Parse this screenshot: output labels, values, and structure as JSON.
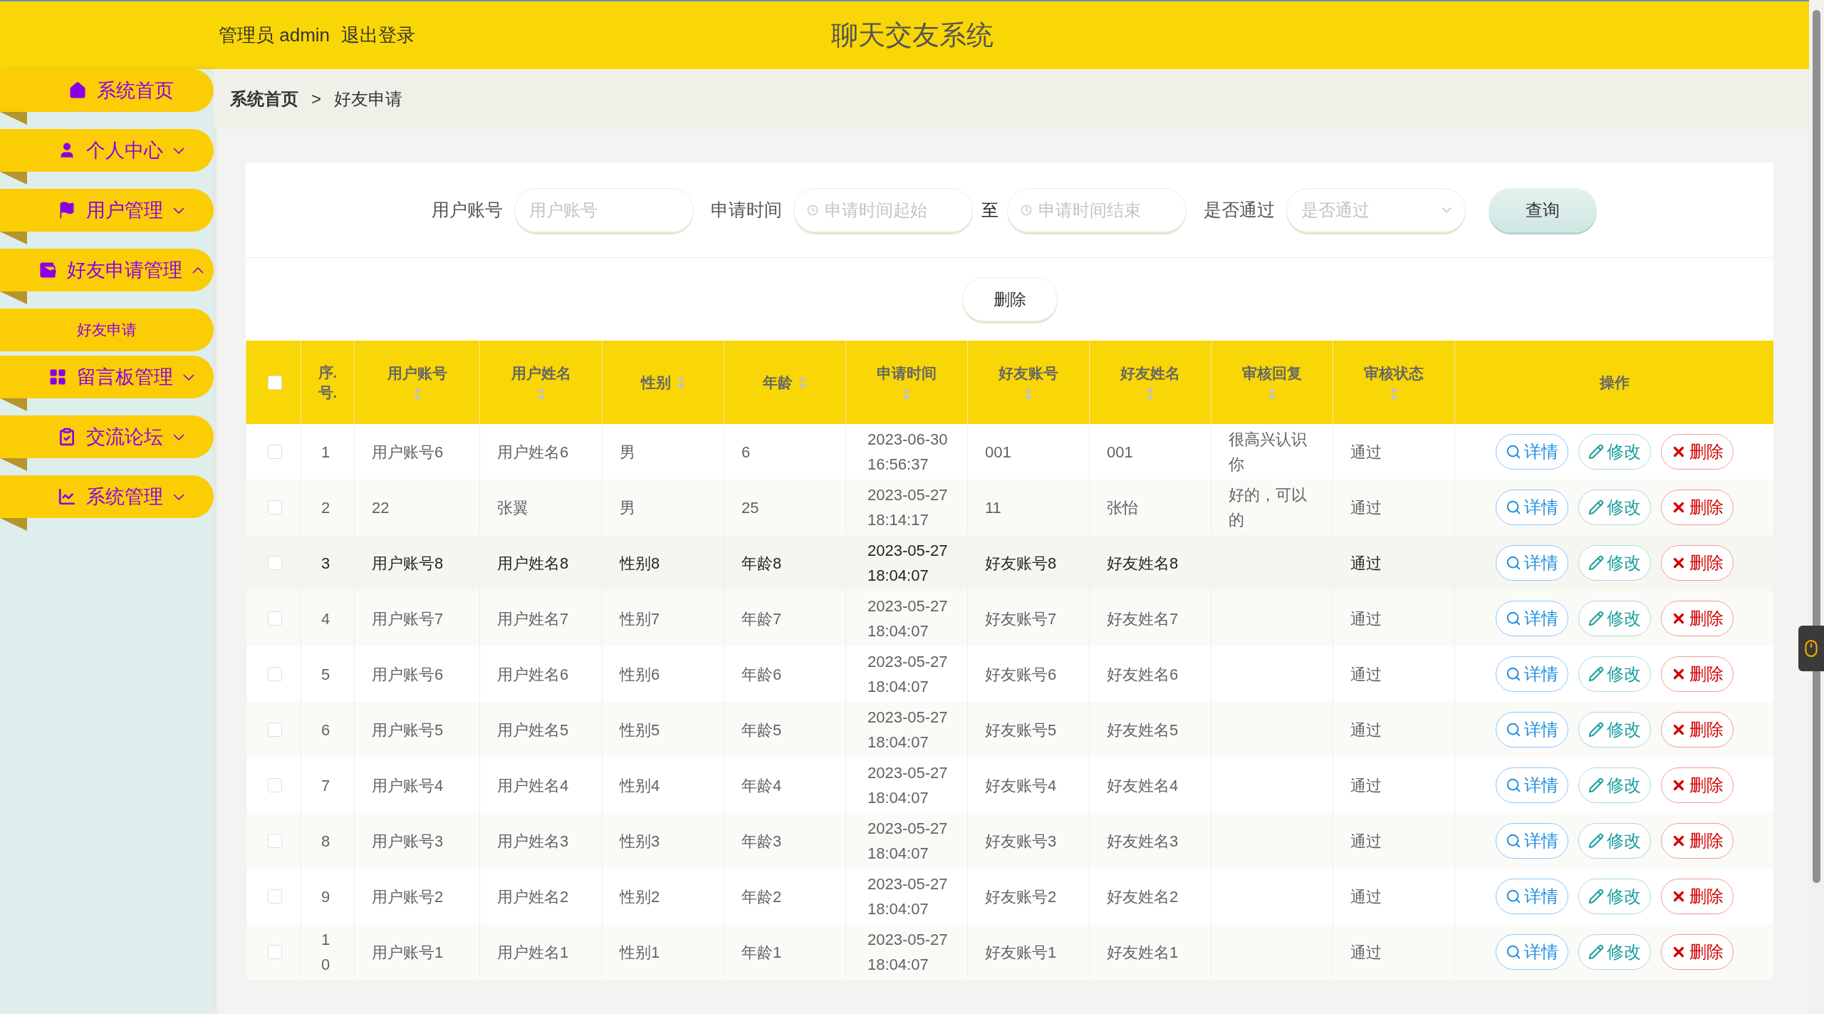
{
  "header": {
    "user_role": "管理员",
    "username": "admin",
    "logout": "退出登录",
    "title": "聊天交友系统"
  },
  "sidebar": {
    "items": [
      {
        "label": "系统首页",
        "kind": "home",
        "expandable": false
      },
      {
        "label": "个人中心",
        "kind": "user",
        "expandable": true,
        "expanded": false
      },
      {
        "label": "用户管理",
        "kind": "flag",
        "expandable": true,
        "expanded": false
      },
      {
        "label": "好友申请管理",
        "kind": "wallet",
        "expandable": true,
        "expanded": true,
        "children": [
          {
            "label": "好友申请"
          }
        ]
      },
      {
        "label": "留言板管理",
        "kind": "grid",
        "expandable": true,
        "expanded": false
      },
      {
        "label": "交流论坛",
        "kind": "clipboard",
        "expandable": true,
        "expanded": false
      },
      {
        "label": "系统管理",
        "kind": "chart",
        "expandable": true,
        "expanded": false
      }
    ]
  },
  "breadcrumb": {
    "items": [
      "系统首页",
      "好友申请"
    ],
    "separator": ">"
  },
  "search": {
    "fields": [
      {
        "kind": "text",
        "label": "用户账号",
        "placeholder": "用户账号"
      },
      {
        "kind": "daterange",
        "label": "申请时间",
        "start_placeholder": "申请时间起始",
        "separator": "至",
        "end_placeholder": "申请时间结束"
      },
      {
        "kind": "select",
        "label": "是否通过",
        "placeholder": "是否通过"
      }
    ],
    "button": "查询"
  },
  "bulk_delete": "删除",
  "table": {
    "select_all": {
      "checked": false
    },
    "columns": [
      {
        "label": "序.号.",
        "sortable": false
      },
      {
        "label": "用户账号",
        "sortable": true
      },
      {
        "label": "用户姓名",
        "sortable": true
      },
      {
        "label": "性别",
        "sortable": true
      },
      {
        "label": "年龄",
        "sortable": true
      },
      {
        "label": "申请时间",
        "sortable": true
      },
      {
        "label": "好友账号",
        "sortable": true
      },
      {
        "label": "好友姓名",
        "sortable": true
      },
      {
        "label": "审核回复",
        "sortable": true
      },
      {
        "label": "审核状态",
        "sortable": true
      },
      {
        "label": "操作",
        "sortable": false
      }
    ],
    "rows": [
      {
        "checked": false,
        "highlighted": false,
        "index": "1",
        "account": "用户账号6",
        "name": "用户姓名6",
        "gender": "男",
        "age": "6",
        "time": "2023-06-30 16:56:37",
        "friend_account": "001",
        "friend_name": "001",
        "reply": "很高兴认识你",
        "status": "通过",
        "actions": [
          "详情",
          "修改",
          "删除"
        ]
      },
      {
        "checked": false,
        "highlighted": false,
        "index": "2",
        "account": "22",
        "name": "张翼",
        "gender": "男",
        "age": "25",
        "time": "2023-05-27 18:14:17",
        "friend_account": "11",
        "friend_name": "张怡",
        "reply": "好的，可以的",
        "status": "通过",
        "actions": [
          "详情",
          "修改",
          "删除"
        ]
      },
      {
        "checked": false,
        "highlighted": true,
        "index": "3",
        "account": "用户账号8",
        "name": "用户姓名8",
        "gender": "性别8",
        "age": "年龄8",
        "time": "2023-05-27 18:04:07",
        "friend_account": "好友账号8",
        "friend_name": "好友姓名8",
        "status": "通过",
        "actions": [
          "详情",
          "修改",
          "删除"
        ]
      },
      {
        "checked": false,
        "highlighted": false,
        "index": "4",
        "account": "用户账号7",
        "name": "用户姓名7",
        "gender": "性别7",
        "age": "年龄7",
        "time": "2023-05-27 18:04:07",
        "friend_account": "好友账号7",
        "friend_name": "好友姓名7",
        "status": "通过",
        "actions": [
          "详情",
          "修改",
          "删除"
        ]
      },
      {
        "checked": false,
        "highlighted": false,
        "index": "5",
        "account": "用户账号6",
        "name": "用户姓名6",
        "gender": "性别6",
        "age": "年龄6",
        "time": "2023-05-27 18:04:07",
        "friend_account": "好友账号6",
        "friend_name": "好友姓名6",
        "status": "通过",
        "actions": [
          "详情",
          "修改",
          "删除"
        ]
      },
      {
        "checked": false,
        "highlighted": false,
        "index": "6",
        "account": "用户账号5",
        "name": "用户姓名5",
        "gender": "性别5",
        "age": "年龄5",
        "time": "2023-05-27 18:04:07",
        "friend_account": "好友账号5",
        "friend_name": "好友姓名5",
        "status": "通过",
        "actions": [
          "详情",
          "修改",
          "删除"
        ]
      },
      {
        "checked": false,
        "highlighted": false,
        "index": "7",
        "account": "用户账号4",
        "name": "用户姓名4",
        "gender": "性别4",
        "age": "年龄4",
        "time": "2023-05-27 18:04:07",
        "friend_account": "好友账号4",
        "friend_name": "好友姓名4",
        "status": "通过",
        "actions": [
          "详情",
          "修改",
          "删除"
        ]
      },
      {
        "checked": false,
        "highlighted": false,
        "index": "8",
        "account": "用户账号3",
        "name": "用户姓名3",
        "gender": "性别3",
        "age": "年龄3",
        "time": "2023-05-27 18:04:07",
        "friend_account": "好友账号3",
        "friend_name": "好友姓名3",
        "status": "通过",
        "actions": [
          "详情",
          "修改",
          "删除"
        ]
      },
      {
        "checked": false,
        "highlighted": false,
        "index": "9",
        "account": "用户账号2",
        "name": "用户姓名2",
        "gender": "性别2",
        "age": "年龄2",
        "time": "2023-05-27 18:04:07",
        "friend_account": "好友账号2",
        "friend_name": "好友姓名2",
        "status": "通过",
        "actions": [
          "详情",
          "修改",
          "删除"
        ]
      },
      {
        "checked": false,
        "highlighted": false,
        "index": "10",
        "account": "用户账号1",
        "name": "用户姓名1",
        "gender": "性别1",
        "age": "年龄1",
        "time": "2023-05-27 18:04:07",
        "friend_account": "好友账号1",
        "friend_name": "好友姓名1",
        "status": "通过",
        "actions": [
          "详情",
          "修改",
          "删除"
        ]
      }
    ]
  }
}
